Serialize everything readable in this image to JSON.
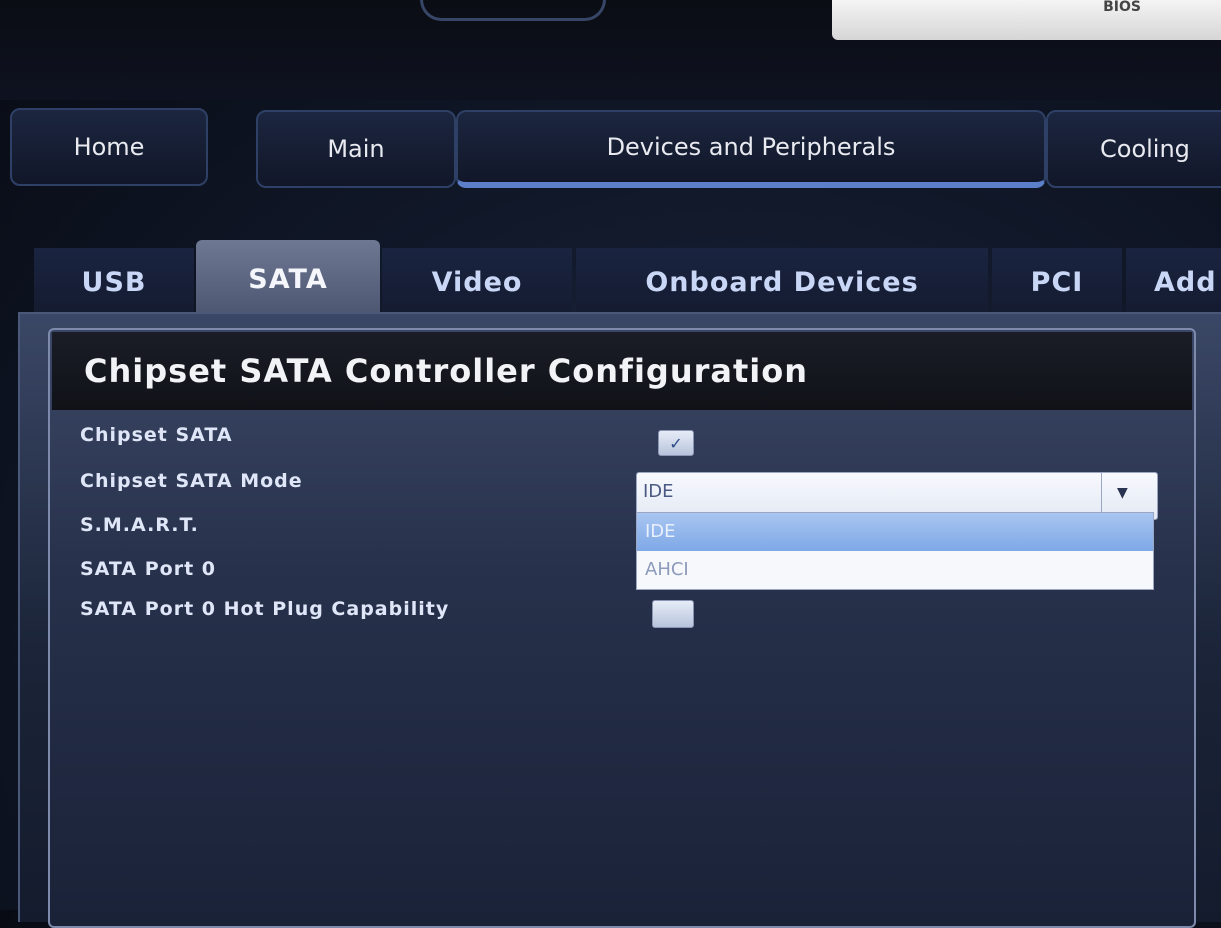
{
  "header": {
    "bios_label": "BIOS"
  },
  "main_tabs": [
    {
      "label": "Home"
    },
    {
      "label": "Main"
    },
    {
      "label": "Devices and Peripherals",
      "active": true
    },
    {
      "label": "Cooling"
    }
  ],
  "sub_tabs": [
    {
      "label": "USB"
    },
    {
      "label": "SATA",
      "active": true
    },
    {
      "label": "Video"
    },
    {
      "label": "Onboard Devices"
    },
    {
      "label": "PCI"
    },
    {
      "label": "Add"
    }
  ],
  "section": {
    "title": "Chipset SATA Controller Configuration"
  },
  "settings": {
    "chipset_sata": {
      "label": "Chipset SATA",
      "checked": true,
      "check_glyph": "✓"
    },
    "chipset_sata_mode": {
      "label": "Chipset SATA Mode",
      "value": "IDE",
      "arrow_glyph": "▼"
    },
    "smart": {
      "label": "S.M.A.R.T."
    },
    "sata_port0": {
      "label": "SATA Port 0"
    },
    "sata_port0_hotplug": {
      "label": "SATA Port 0 Hot Plug Capability",
      "checked": false
    }
  },
  "mode_options": [
    "IDE",
    "AHCI"
  ],
  "colors": {
    "accent": "#5b7fc8",
    "selected_option": "#8fb3ec"
  }
}
